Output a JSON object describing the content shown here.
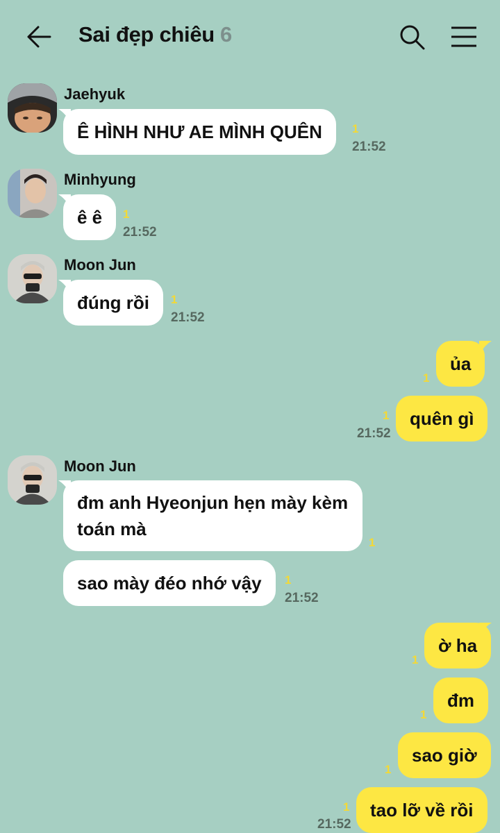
{
  "header": {
    "title": "Sai đẹp chiêu",
    "member_count": "6"
  },
  "messages": {
    "m1": {
      "sender": "Jaehyuk",
      "text": "Ê HÌNH NHƯ AE MÌNH QUÊN",
      "unread": "1",
      "time": "21:52"
    },
    "m2": {
      "sender": "Minhyung",
      "text": "ê ê",
      "unread": "1",
      "time": "21:52"
    },
    "m3": {
      "sender": "Moon Jun",
      "text": "đúng rồi",
      "unread": "1",
      "time": "21:52"
    },
    "o1": {
      "text": "ủa",
      "unread": "1"
    },
    "o2": {
      "text": "quên gì",
      "unread": "1",
      "time": "21:52"
    },
    "m4": {
      "sender": "Moon Jun",
      "text": "đm anh Hyeonjun hẹn mày kèm toán mà",
      "unread": "1"
    },
    "m5": {
      "text": "sao mày đéo nhớ vậy",
      "unread": "1",
      "time": "21:52"
    },
    "o3": {
      "text": "ờ ha",
      "unread": "1"
    },
    "o4": {
      "text": "đm",
      "unread": "1"
    },
    "o5": {
      "text": "sao giờ",
      "unread": "1"
    },
    "o6": {
      "text": "tao lỡ về rồi",
      "unread": "1",
      "time": "21:52"
    }
  },
  "colors": {
    "background": "#a6cfc2",
    "incoming_bubble": "#ffffff",
    "outgoing_bubble": "#fde743",
    "unread_count": "#f3d936",
    "timestamp": "#56685f"
  },
  "icons": {
    "back": "arrow-left-icon",
    "search": "search-icon",
    "menu": "hamburger-menu-icon"
  }
}
